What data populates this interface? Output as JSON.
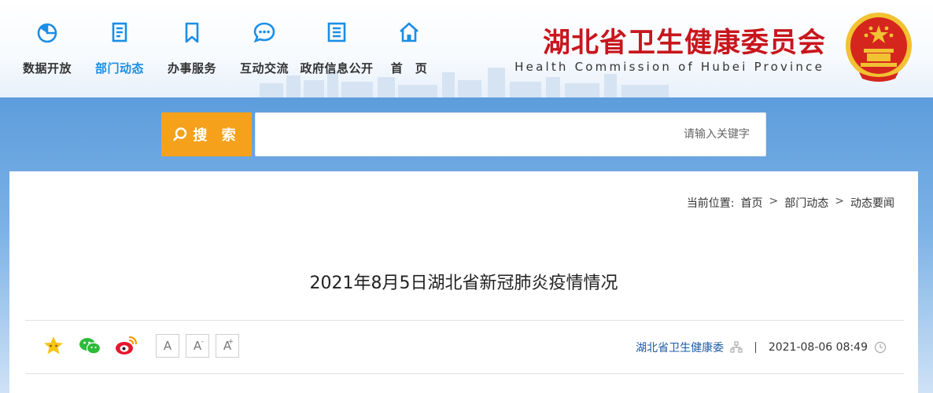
{
  "header": {
    "site_title": "湖北省卫生健康委员会",
    "site_title_en": "Health Commission of Hubei Province",
    "nav": [
      {
        "label": "数据开放",
        "icon": "data-pie-icon"
      },
      {
        "label": "部门动态",
        "icon": "document-icon",
        "active": true
      },
      {
        "label": "办事服务",
        "icon": "bookmark-icon"
      },
      {
        "label": "互动交流",
        "icon": "chat-bubble-icon"
      },
      {
        "label": "政府信息公开",
        "icon": "list-doc-icon"
      },
      {
        "label": "首　页",
        "icon": "home-icon"
      }
    ]
  },
  "search": {
    "button_label": "搜 索",
    "placeholder": "请输入关键字"
  },
  "breadcrumb": {
    "prefix": "当前位置:",
    "items": [
      "首页",
      "部门动态",
      "动态要闻"
    ],
    "separator": ">"
  },
  "article": {
    "title": "2021年8月5日湖北省新冠肺炎疫情情况",
    "datetime": "2021-08-06 08:49",
    "meta_separator": "|",
    "source": "湖北省卫生健康委"
  },
  "tools": {
    "font_sizes": [
      "A",
      "A",
      "A"
    ],
    "font_marks": [
      "",
      "-",
      "+"
    ],
    "share": [
      "favorite-star-icon",
      "wechat-icon",
      "weibo-icon"
    ]
  },
  "colors": {
    "brand_red": "#c8161d",
    "nav_active": "#1a8ee6",
    "search_orange": "#f5a11b",
    "source_blue": "#1c5aa8"
  }
}
